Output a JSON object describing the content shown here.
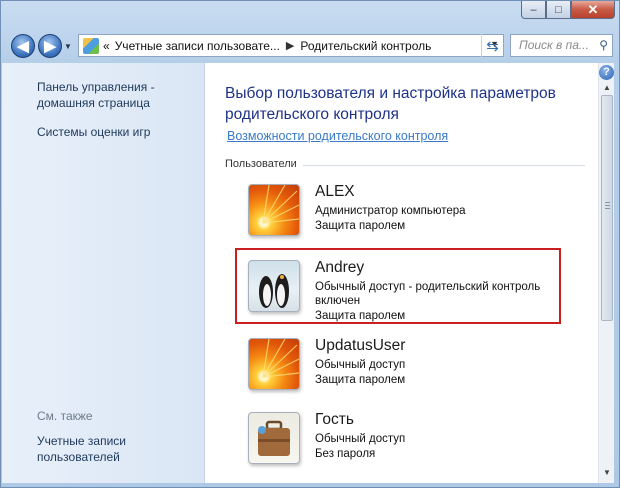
{
  "window": {
    "caption": {
      "minimize": "–",
      "maximize": "□",
      "close": "✕"
    }
  },
  "nav": {
    "back": "◀",
    "forward": "▶",
    "address": {
      "chevrons": "«",
      "crumb1": "Учетные записи пользовате...",
      "separator": "▶",
      "crumb2": "Родительский контроль"
    },
    "search_placeholder": "Поиск в па..."
  },
  "left_pane": {
    "home_link": "Панель управления - домашняя страница",
    "ratings_link": "Системы оценки игр",
    "see_also": "См. также",
    "accounts_link": "Учетные записи пользователей"
  },
  "main": {
    "title": "Выбор пользователя и настройка параметров родительского контроля",
    "features_link": "Возможности родительского контроля",
    "users_header": "Пользователи",
    "users": [
      {
        "name": "ALEX",
        "avatar": "flower-avatar",
        "lines": [
          "Администратор компьютера",
          "Защита паролем"
        ]
      },
      {
        "name": "Andrey",
        "avatar": "penguin-avatar",
        "lines": [
          "Обычный доступ - родительский контроль",
          "включен",
          "Защита паролем"
        ]
      },
      {
        "name": "UpdatusUser",
        "avatar": "flower-avatar",
        "lines": [
          "Обычный доступ",
          "Защита паролем"
        ]
      },
      {
        "name": "Гость",
        "avatar": "suitcase-avatar",
        "lines": [
          "Обычный доступ",
          "Без пароля"
        ]
      }
    ],
    "highlight_color": "#c8201f"
  },
  "help": "?",
  "colors": {
    "title": "#1e3287",
    "link": "#3a7ac8",
    "left_link": "#1e395b"
  }
}
